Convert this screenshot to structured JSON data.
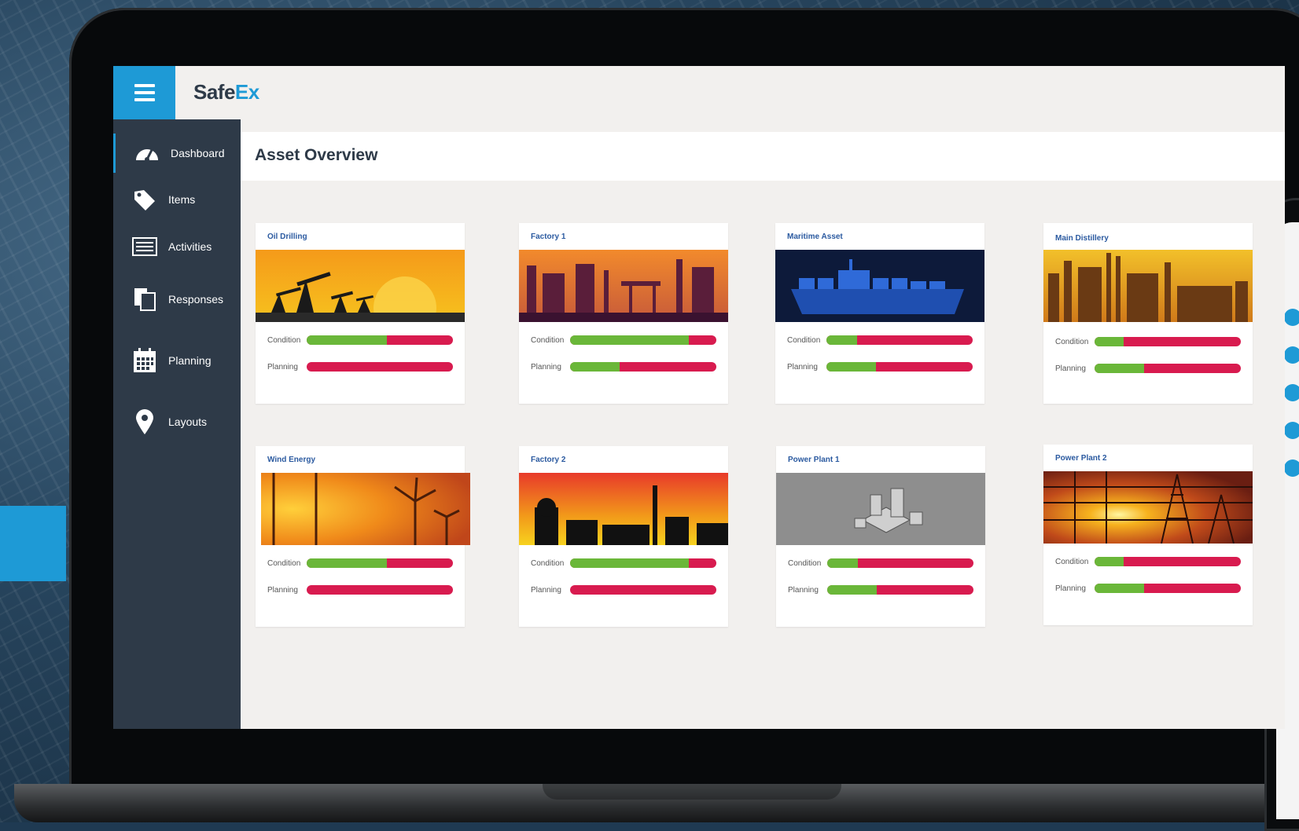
{
  "app": {
    "logo_main": "SafeEx",
    "logo_prefix": "Safe",
    "logo_suffix": "Ex"
  },
  "sidebar": {
    "items": [
      {
        "label": "Dashboard",
        "icon": "speedometer-icon",
        "active": true
      },
      {
        "label": "Items",
        "icon": "tags-icon"
      },
      {
        "label": "Activities",
        "icon": "list-icon"
      },
      {
        "label": "Responses",
        "icon": "documents-icon"
      },
      {
        "label": "Planning",
        "icon": "calendar-icon"
      },
      {
        "label": "Layouts",
        "icon": "map-pin-icon"
      }
    ]
  },
  "page": {
    "title": "Asset Overview"
  },
  "metric_labels": {
    "condition": "Condition",
    "planning": "Planning"
  },
  "colors": {
    "accent": "#1e9ad6",
    "sidebar": "#2e3a48",
    "good": "#6ab739",
    "bad": "#d81b4f"
  },
  "assets": [
    {
      "name": "Oil Drilling",
      "condition": 0.55,
      "planning": 0.0
    },
    {
      "name": "Factory 1",
      "condition": 0.81,
      "planning": 0.34
    },
    {
      "name": "Maritime Asset",
      "condition": 0.21,
      "planning": 0.34
    },
    {
      "name": "Main Distillery",
      "condition": 0.2,
      "planning": 0.34
    },
    {
      "name": "Wind Energy",
      "condition": 0.55,
      "planning": 0.0
    },
    {
      "name": "Factory 2",
      "condition": 0.81,
      "planning": 0.0
    },
    {
      "name": "Power Plant 1",
      "condition": 0.21,
      "planning": 0.34
    },
    {
      "name": "Power Plant 2",
      "condition": 0.2,
      "planning": 0.34
    }
  ]
}
